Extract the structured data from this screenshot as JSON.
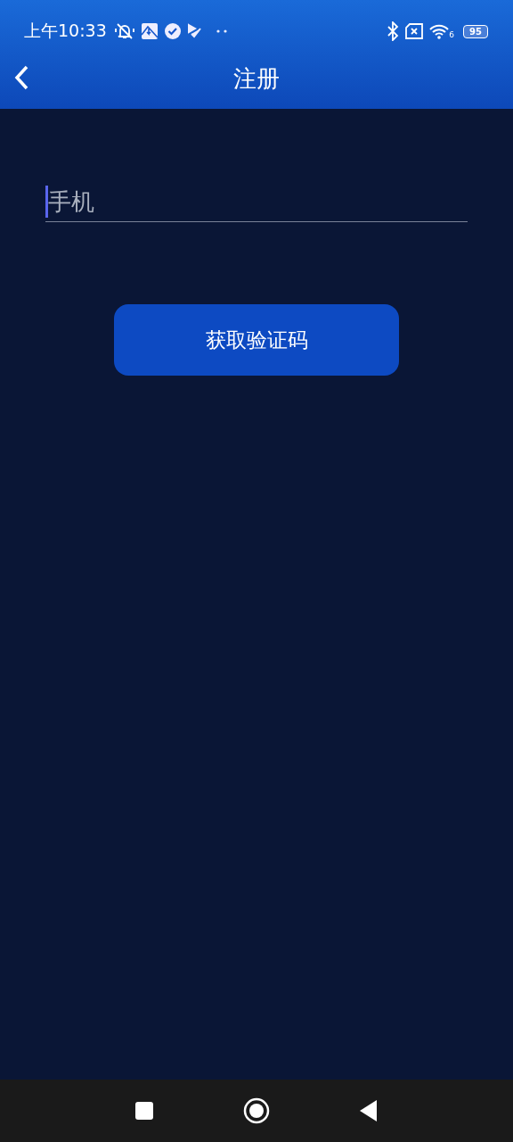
{
  "status_bar": {
    "time": "上午10:33",
    "wifi_label": "6",
    "battery": "95"
  },
  "header": {
    "title": "注册"
  },
  "phone_field": {
    "placeholder": "手机"
  },
  "get_code_button": {
    "label": "获取验证码"
  }
}
